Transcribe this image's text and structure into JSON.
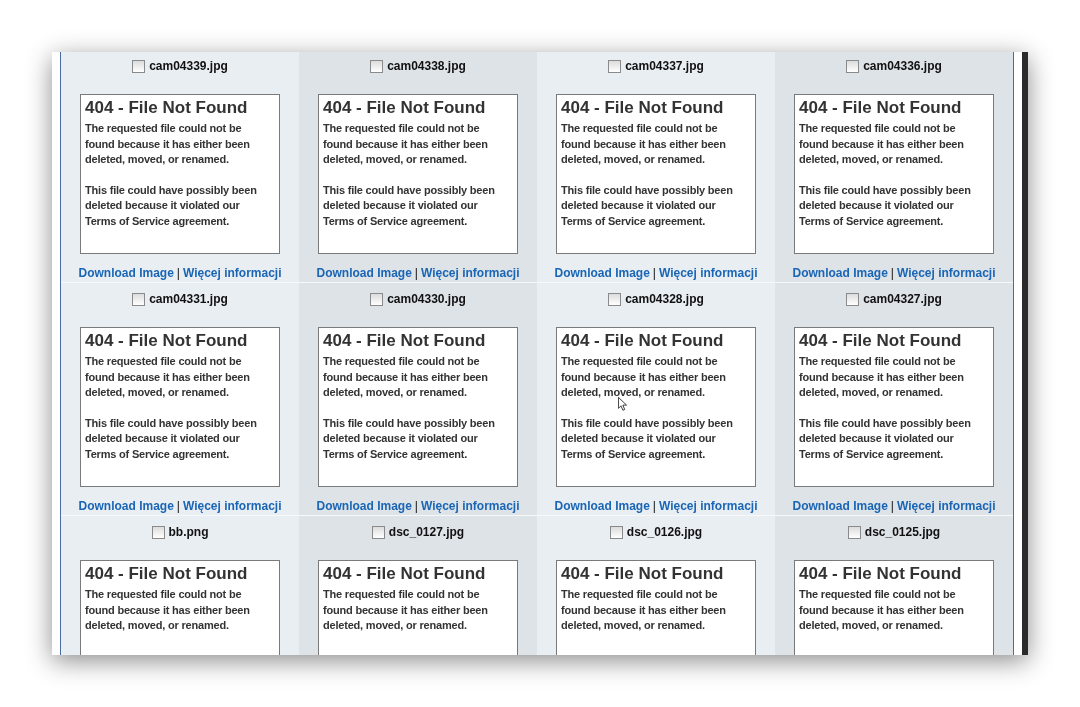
{
  "cards": [
    {
      "filename": "cam04339.jpg",
      "checked": false,
      "error_title": "404 - File Not Found",
      "paragraphs": [
        "The requested file could not be found because it has either been deleted, moved, or renamed.",
        "This file could have possibly been deleted because it violated our Terms of Service agreement."
      ],
      "links": [
        "Download Image",
        "Więcej informacji"
      ],
      "separator": "|"
    },
    {
      "filename": "cam04338.jpg",
      "checked": false,
      "error_title": "404 - File Not Found",
      "paragraphs": [
        "The requested file could not be found because it has either been deleted, moved, or renamed.",
        "This file could have possibly been deleted because it violated our Terms of Service agreement."
      ],
      "links": [
        "Download Image",
        "Więcej informacji"
      ],
      "separator": "|"
    },
    {
      "filename": "cam04337.jpg",
      "checked": false,
      "error_title": "404 - File Not Found",
      "paragraphs": [
        "The requested file could not be found because it has either been deleted, moved, or renamed.",
        "This file could have possibly been deleted because it violated our Terms of Service agreement."
      ],
      "links": [
        "Download Image",
        "Więcej informacji"
      ],
      "separator": "|"
    },
    {
      "filename": "cam04336.jpg",
      "checked": false,
      "error_title": "404 - File Not Found",
      "paragraphs": [
        "The requested file could not be found because it has either been deleted, moved, or renamed.",
        "This file could have possibly been deleted because it violated our Terms of Service agreement."
      ],
      "links": [
        "Download Image",
        "Więcej informacji"
      ],
      "separator": "|"
    },
    {
      "filename": "cam04331.jpg",
      "checked": false,
      "error_title": "404 - File Not Found",
      "paragraphs": [
        "The requested file could not be found because it has either been deleted, moved, or renamed.",
        "This file could have possibly been deleted because it violated our Terms of Service agreement."
      ],
      "links": [
        "Download Image",
        "Więcej informacji"
      ],
      "separator": "|"
    },
    {
      "filename": "cam04330.jpg",
      "checked": false,
      "error_title": "404 - File Not Found",
      "paragraphs": [
        "The requested file could not be found because it has either been deleted, moved, or renamed.",
        "This file could have possibly been deleted because it violated our Terms of Service agreement."
      ],
      "links": [
        "Download Image",
        "Więcej informacji"
      ],
      "separator": "|"
    },
    {
      "filename": "cam04328.jpg",
      "checked": false,
      "error_title": "404 - File Not Found",
      "paragraphs": [
        "The requested file could not be found because it has either been deleted, moved, or renamed.",
        "This file could have possibly been deleted because it violated our Terms of Service agreement."
      ],
      "links": [
        "Download Image",
        "Więcej informacji"
      ],
      "separator": "|",
      "cursor": true
    },
    {
      "filename": "cam04327.jpg",
      "checked": false,
      "error_title": "404 - File Not Found",
      "paragraphs": [
        "The requested file could not be found because it has either been deleted, moved, or renamed.",
        "This file could have possibly been deleted because it violated our Terms of Service agreement."
      ],
      "links": [
        "Download Image",
        "Więcej informacji"
      ],
      "separator": "|"
    },
    {
      "filename": "bb.png",
      "checked": false,
      "error_title": "404 - File Not Found",
      "paragraphs": [
        "The requested file could not be found because it has either been deleted, moved, or renamed."
      ]
    },
    {
      "filename": "dsc_0127.jpg",
      "checked": false,
      "error_title": "404 - File Not Found",
      "paragraphs": [
        "The requested file could not be found because it has either been deleted, moved, or renamed."
      ]
    },
    {
      "filename": "dsc_0126.jpg",
      "checked": false,
      "error_title": "404 - File Not Found",
      "paragraphs": [
        "The requested file could not be found because it has either been deleted, moved, or renamed."
      ]
    },
    {
      "filename": "dsc_0125.jpg",
      "checked": false,
      "error_title": "404 - File Not Found",
      "paragraphs": [
        "The requested file could not be found because it has either been deleted, moved, or renamed."
      ]
    }
  ]
}
